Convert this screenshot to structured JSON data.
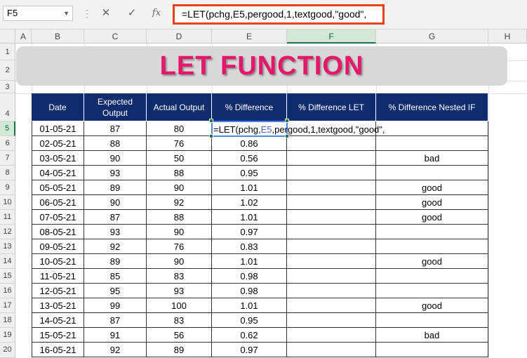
{
  "formula_bar": {
    "name_box": "F5",
    "cancel_icon": "✕",
    "enter_icon": "✓",
    "fx_label": "fx",
    "formula": "=LET(pchg,E5,pergood,1,textgood,\"good\","
  },
  "columns": [
    "A",
    "B",
    "C",
    "D",
    "E",
    "F",
    "G",
    "H"
  ],
  "rows": [
    "1",
    "2",
    "3",
    "4",
    "5",
    "6",
    "7",
    "8",
    "9",
    "10",
    "11",
    "12",
    "13",
    "14",
    "15",
    "16",
    "17",
    "18",
    "19",
    "20"
  ],
  "banner": {
    "title": "LET FUNCTION"
  },
  "table": {
    "headers": [
      "Date",
      "Expected Output",
      "Actual Output",
      "% Difference",
      "% Difference LET",
      "% Difference Nested IF"
    ],
    "editing": {
      "prefix": "=LET(pchg,",
      "ref": "E5",
      "suffix": ",pergood,1,textgood,\"good\","
    },
    "rows": [
      {
        "date": "01-05-21",
        "expected": "87",
        "actual": "80",
        "diff": "",
        "let": "",
        "nested": ""
      },
      {
        "date": "02-05-21",
        "expected": "88",
        "actual": "76",
        "diff": "0.86",
        "let": "",
        "nested": ""
      },
      {
        "date": "03-05-21",
        "expected": "90",
        "actual": "50",
        "diff": "0.56",
        "let": "",
        "nested": "bad"
      },
      {
        "date": "04-05-21",
        "expected": "93",
        "actual": "88",
        "diff": "0.95",
        "let": "",
        "nested": ""
      },
      {
        "date": "05-05-21",
        "expected": "89",
        "actual": "90",
        "diff": "1.01",
        "let": "",
        "nested": "good"
      },
      {
        "date": "06-05-21",
        "expected": "90",
        "actual": "92",
        "diff": "1.02",
        "let": "",
        "nested": "good"
      },
      {
        "date": "07-05-21",
        "expected": "87",
        "actual": "88",
        "diff": "1.01",
        "let": "",
        "nested": "good"
      },
      {
        "date": "08-05-21",
        "expected": "93",
        "actual": "90",
        "diff": "0.97",
        "let": "",
        "nested": ""
      },
      {
        "date": "09-05-21",
        "expected": "92",
        "actual": "76",
        "diff": "0.83",
        "let": "",
        "nested": ""
      },
      {
        "date": "10-05-21",
        "expected": "89",
        "actual": "90",
        "diff": "1.01",
        "let": "",
        "nested": "good"
      },
      {
        "date": "11-05-21",
        "expected": "85",
        "actual": "83",
        "diff": "0.98",
        "let": "",
        "nested": ""
      },
      {
        "date": "12-05-21",
        "expected": "95",
        "actual": "93",
        "diff": "0.98",
        "let": "",
        "nested": ""
      },
      {
        "date": "13-05-21",
        "expected": "99",
        "actual": "100",
        "diff": "1.01",
        "let": "",
        "nested": "good"
      },
      {
        "date": "14-05-21",
        "expected": "87",
        "actual": "83",
        "diff": "0.95",
        "let": "",
        "nested": ""
      },
      {
        "date": "15-05-21",
        "expected": "91",
        "actual": "56",
        "diff": "0.62",
        "let": "",
        "nested": "bad"
      },
      {
        "date": "16-05-21",
        "expected": "92",
        "actual": "89",
        "diff": "0.97",
        "let": "",
        "nested": ""
      }
    ]
  },
  "colors": {
    "header_bg": "#0f2d6e",
    "title": "#e8166b",
    "highlight_border": "#e8401c",
    "active_header": "#217346"
  }
}
